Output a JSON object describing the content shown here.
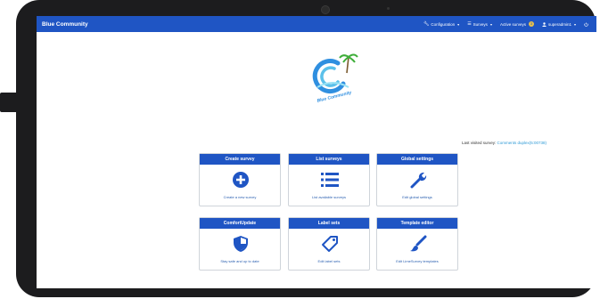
{
  "navbar": {
    "brand": "Blue Community",
    "items": [
      {
        "label": "Configuration",
        "icon": "wrench-icon",
        "caret": "▾"
      },
      {
        "label": "Surveys",
        "icon": "list-icon",
        "caret": "▾"
      },
      {
        "label": "Active surveys",
        "badge": "3"
      },
      {
        "label": "superadmin1",
        "icon": "user-icon",
        "caret": "▾"
      }
    ],
    "extra_icon": "logout-icon"
  },
  "logo": {
    "text": "Blue Community"
  },
  "last_visited": {
    "prefix": "Last visited survey:",
    "link": "Comments duplex(5:00738)"
  },
  "cards": [
    {
      "title": "Create survey",
      "text": "Create a new survey",
      "icon": "plus-circle-icon"
    },
    {
      "title": "List surveys",
      "text": "List available surveys",
      "icon": "list-icon"
    },
    {
      "title": "Global settings",
      "text": "Edit global settings",
      "icon": "wrench-icon"
    },
    {
      "title": "ComfortUpdate",
      "text": "Stay safe and up to date",
      "icon": "shield-icon"
    },
    {
      "title": "Label sets",
      "text": "Edit label sets",
      "icon": "tag-icon"
    },
    {
      "title": "Template editor",
      "text": "Edit LimeSurvey templates",
      "icon": "brush-icon"
    }
  ],
  "colors": {
    "primary": "#1f55c4",
    "link": "#2e9ad6",
    "bezel": "#1c1c1e"
  }
}
